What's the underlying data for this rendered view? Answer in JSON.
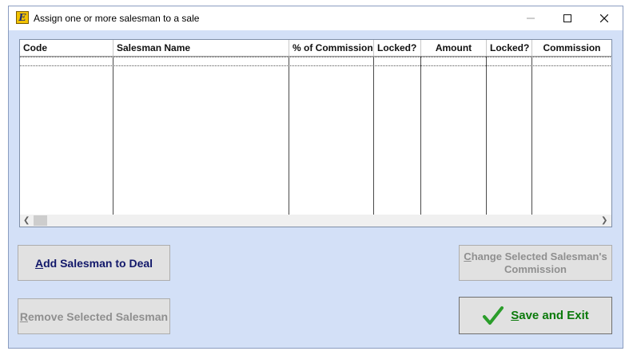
{
  "window": {
    "title": "Assign one or more salesman to a sale",
    "icon_letter": "E"
  },
  "grid": {
    "columns": [
      "Code",
      "Salesman Name",
      "% of Commission",
      "Locked?",
      "Amount",
      "Locked?",
      "Commission"
    ],
    "rows": []
  },
  "buttons": {
    "add": {
      "access_key": "A",
      "rest": "dd Salesman to Deal"
    },
    "remove": {
      "access_key": "R",
      "rest": "emove Selected Salesman"
    },
    "change": {
      "access_key": "C",
      "rest_line1": "hange Selected Salesman's",
      "line2": "Commission"
    },
    "save": {
      "access_key": "S",
      "rest": "ave and Exit"
    }
  },
  "colors": {
    "background": "#d3e0f7",
    "save_text": "#0b7a0b",
    "add_text": "#12186a",
    "disabled_text": "#8f8f8f"
  },
  "icons": [
    "app-icon",
    "minimize-icon",
    "maximize-icon",
    "close-icon",
    "scroll-left-icon",
    "scroll-right-icon",
    "checkmark-icon"
  ]
}
